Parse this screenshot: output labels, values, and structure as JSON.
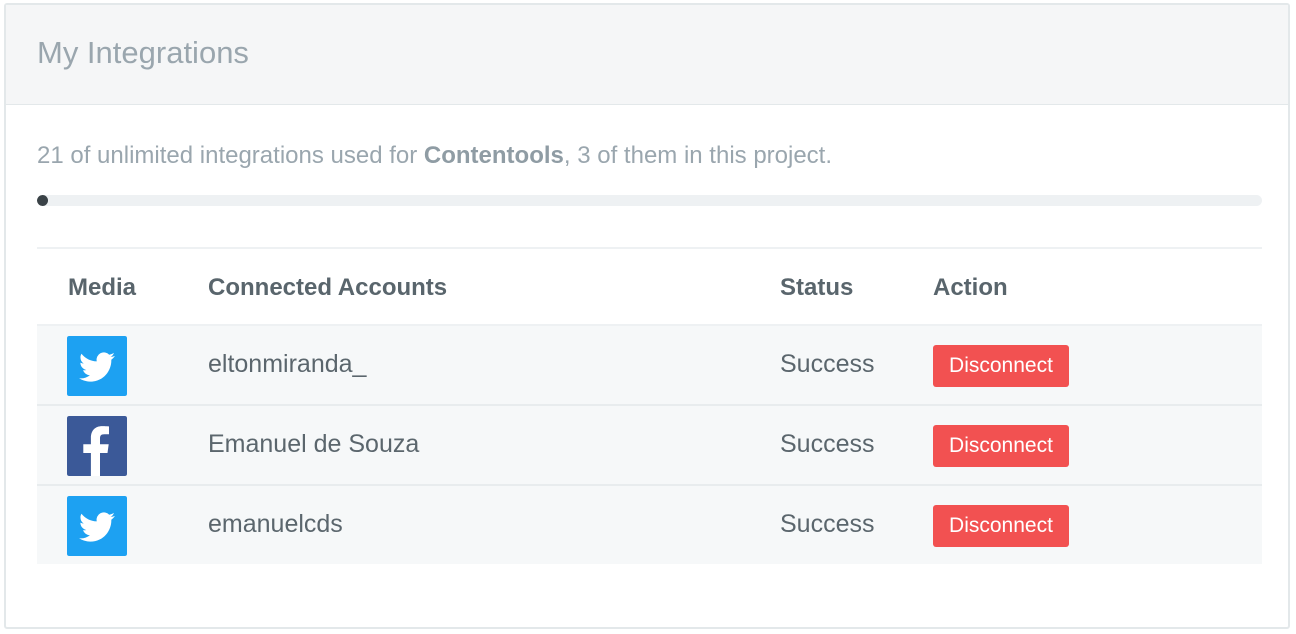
{
  "header": {
    "title": "My Integrations"
  },
  "usage": {
    "text_before": "21 of unlimited integrations used for ",
    "project_name": "Contentools",
    "text_after": ", 3 of them in this project.",
    "progress_fraction": 0.0
  },
  "table": {
    "headers": {
      "media": "Media",
      "accounts": "Connected Accounts",
      "status": "Status",
      "action": "Action"
    },
    "rows": [
      {
        "media": "twitter",
        "account": "eltonmiranda_",
        "status": "Success",
        "action": "Disconnect"
      },
      {
        "media": "facebook",
        "account": "Emanuel de Souza",
        "status": "Success",
        "action": "Disconnect"
      },
      {
        "media": "twitter",
        "account": "emanuelcds",
        "status": "Success",
        "action": "Disconnect"
      }
    ]
  },
  "colors": {
    "twitter": "#1da1f2",
    "facebook": "#3b5998",
    "danger": "#f25151",
    "progress": "#3a4247"
  },
  "icons": {
    "twitter": "twitter-icon",
    "facebook": "facebook-icon"
  }
}
